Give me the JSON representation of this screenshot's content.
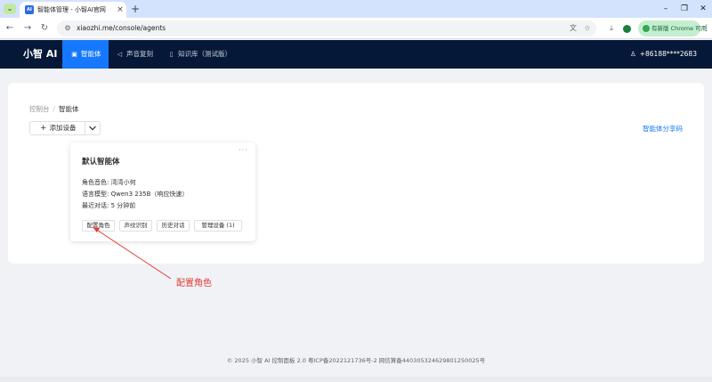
{
  "browser": {
    "tab_title": "智能体管理 - 小智AI官网",
    "tab_close": "×",
    "tab_favicon": "AI",
    "new_tab": "+",
    "url": "xiaozhi.me/console/agents",
    "update_label": "有新版 Chrome 可用",
    "icons": [
      "back-icon",
      "forward-icon",
      "reload-icon",
      "site-info-icon",
      "translate-icon",
      "bookmark-star-icon",
      "download-icon",
      "profile-icon",
      "menu-icon"
    ]
  },
  "app": {
    "brand": "小智 AI",
    "nav": [
      {
        "label": "智能体",
        "active": true,
        "icon": "agent-icon"
      },
      {
        "label": "声音复刻",
        "active": false,
        "icon": "voice-icon"
      },
      {
        "label": "知识库（测试版）",
        "active": false,
        "icon": "document-icon"
      }
    ],
    "user_phone": "+86188****2683"
  },
  "main": {
    "breadcrumb": {
      "root": "控制台",
      "separator": "/",
      "current": "智能体"
    },
    "add_device_label": "添加设备",
    "share_code_label": "智能体分享码",
    "agent_card": {
      "title": "默认智能体",
      "more": "···",
      "voice_label": "角色音色:",
      "voice_value": "湾湾小何",
      "model_label": "语言模型:",
      "model_value": "Qwen3 235B（响应快速）",
      "last_chat_label": "最近对话:",
      "last_chat_value": "5 分钟前",
      "buttons": [
        "配置角色",
        "声纹识别",
        "历史对话",
        "管理设备 (1)"
      ]
    }
  },
  "annotation": {
    "text": "配置角色",
    "color": "#e53935"
  },
  "footer": "© 2025 小智 AI 控制面板 2.0 粤ICP备2022121736号-2 网信算备440305324629801250025号",
  "colors": {
    "header_bg": "#061838",
    "accent": "#1677ff",
    "page_bg": "#f0f2f5",
    "annotation": "#e53935"
  }
}
